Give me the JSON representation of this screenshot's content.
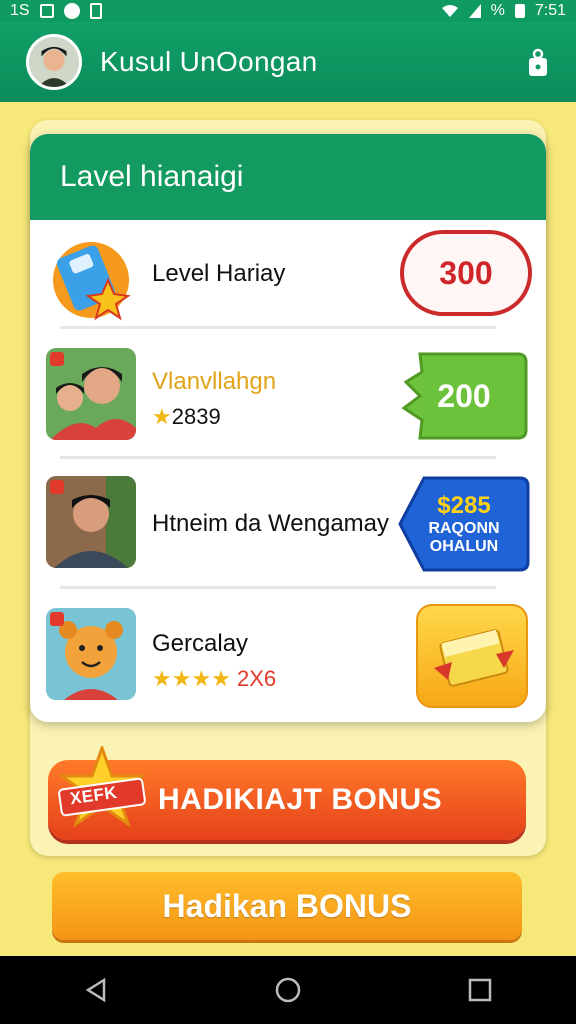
{
  "status_bar": {
    "left_text": "1S",
    "battery_text": "%",
    "time": "7:51"
  },
  "app_bar": {
    "title": "Kusul UnOongan"
  },
  "card": {
    "header": "Lavel hianaigi",
    "rows": [
      {
        "name": "Level Hariay",
        "badge": "300",
        "icon": "gift-card-icon"
      },
      {
        "name": "Vlanvllahgn",
        "rating_value": "2839",
        "badge": "200",
        "icon": "family-photo"
      },
      {
        "name": "Htneim da Wengamay",
        "badge_line1": "$285",
        "badge_line2": "RAQONN",
        "badge_line3": "OHALUN",
        "icon": "man-photo"
      },
      {
        "name": "Gercalay",
        "rating_text": "2X6",
        "stars": 4,
        "icon": "bear-photo"
      }
    ]
  },
  "bonus_button": {
    "label": "HADIKIAJT BONUS",
    "badge": "XEFK"
  },
  "bonus_button_2": {
    "label": "Hadikan BONUS"
  },
  "colors": {
    "green": "#139a61",
    "yellow_bg": "#f7e87a",
    "orange": "#e5411a"
  }
}
